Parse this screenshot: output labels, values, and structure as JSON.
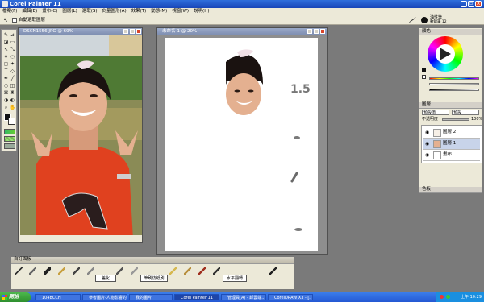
{
  "app_title": "Corel Painter 11",
  "menu": [
    "檔案(F)",
    "編輯(E)",
    "畫布(C)",
    "圖層(L)",
    "選取(S)",
    "向量圖形(A)",
    "效果(T)",
    "動態(M)",
    "視窗(W)",
    "說明(H)"
  ],
  "propbar": {
    "checkbox_label": "自動選取圖層"
  },
  "brush_display": {
    "name": "油性筆",
    "variant": "軟鉛筆 12"
  },
  "photo_window": {
    "title": "DSCN1556.JPG @ 69%"
  },
  "canvas_window": {
    "title": "未命名-1 @ 20%",
    "canvas_text": "1.5"
  },
  "colors_panel": {
    "title": "顏色"
  },
  "layers_panel": {
    "title": "圖層",
    "mode": "預設值",
    "paper": "預設",
    "opacity_label": "不透明度",
    "opacity_value": "100%",
    "layers": [
      "圖層 2",
      "圖層 1",
      "畫布"
    ],
    "footer": "色板"
  },
  "palette": {
    "title": "自訂面板",
    "buttons": [
      "差化",
      "筆刷仿紙刷",
      "水平翻轉"
    ]
  },
  "taskbar": {
    "start": "開始",
    "tasks": [
      "104BCCH",
      "參考圖片-人物影響的...",
      "我的圖片",
      "Corel Painter 11",
      "管理員(A) - 卸雲端...",
      "CorelDRAW X3 - [..."
    ],
    "clock": "上午 10:29"
  }
}
